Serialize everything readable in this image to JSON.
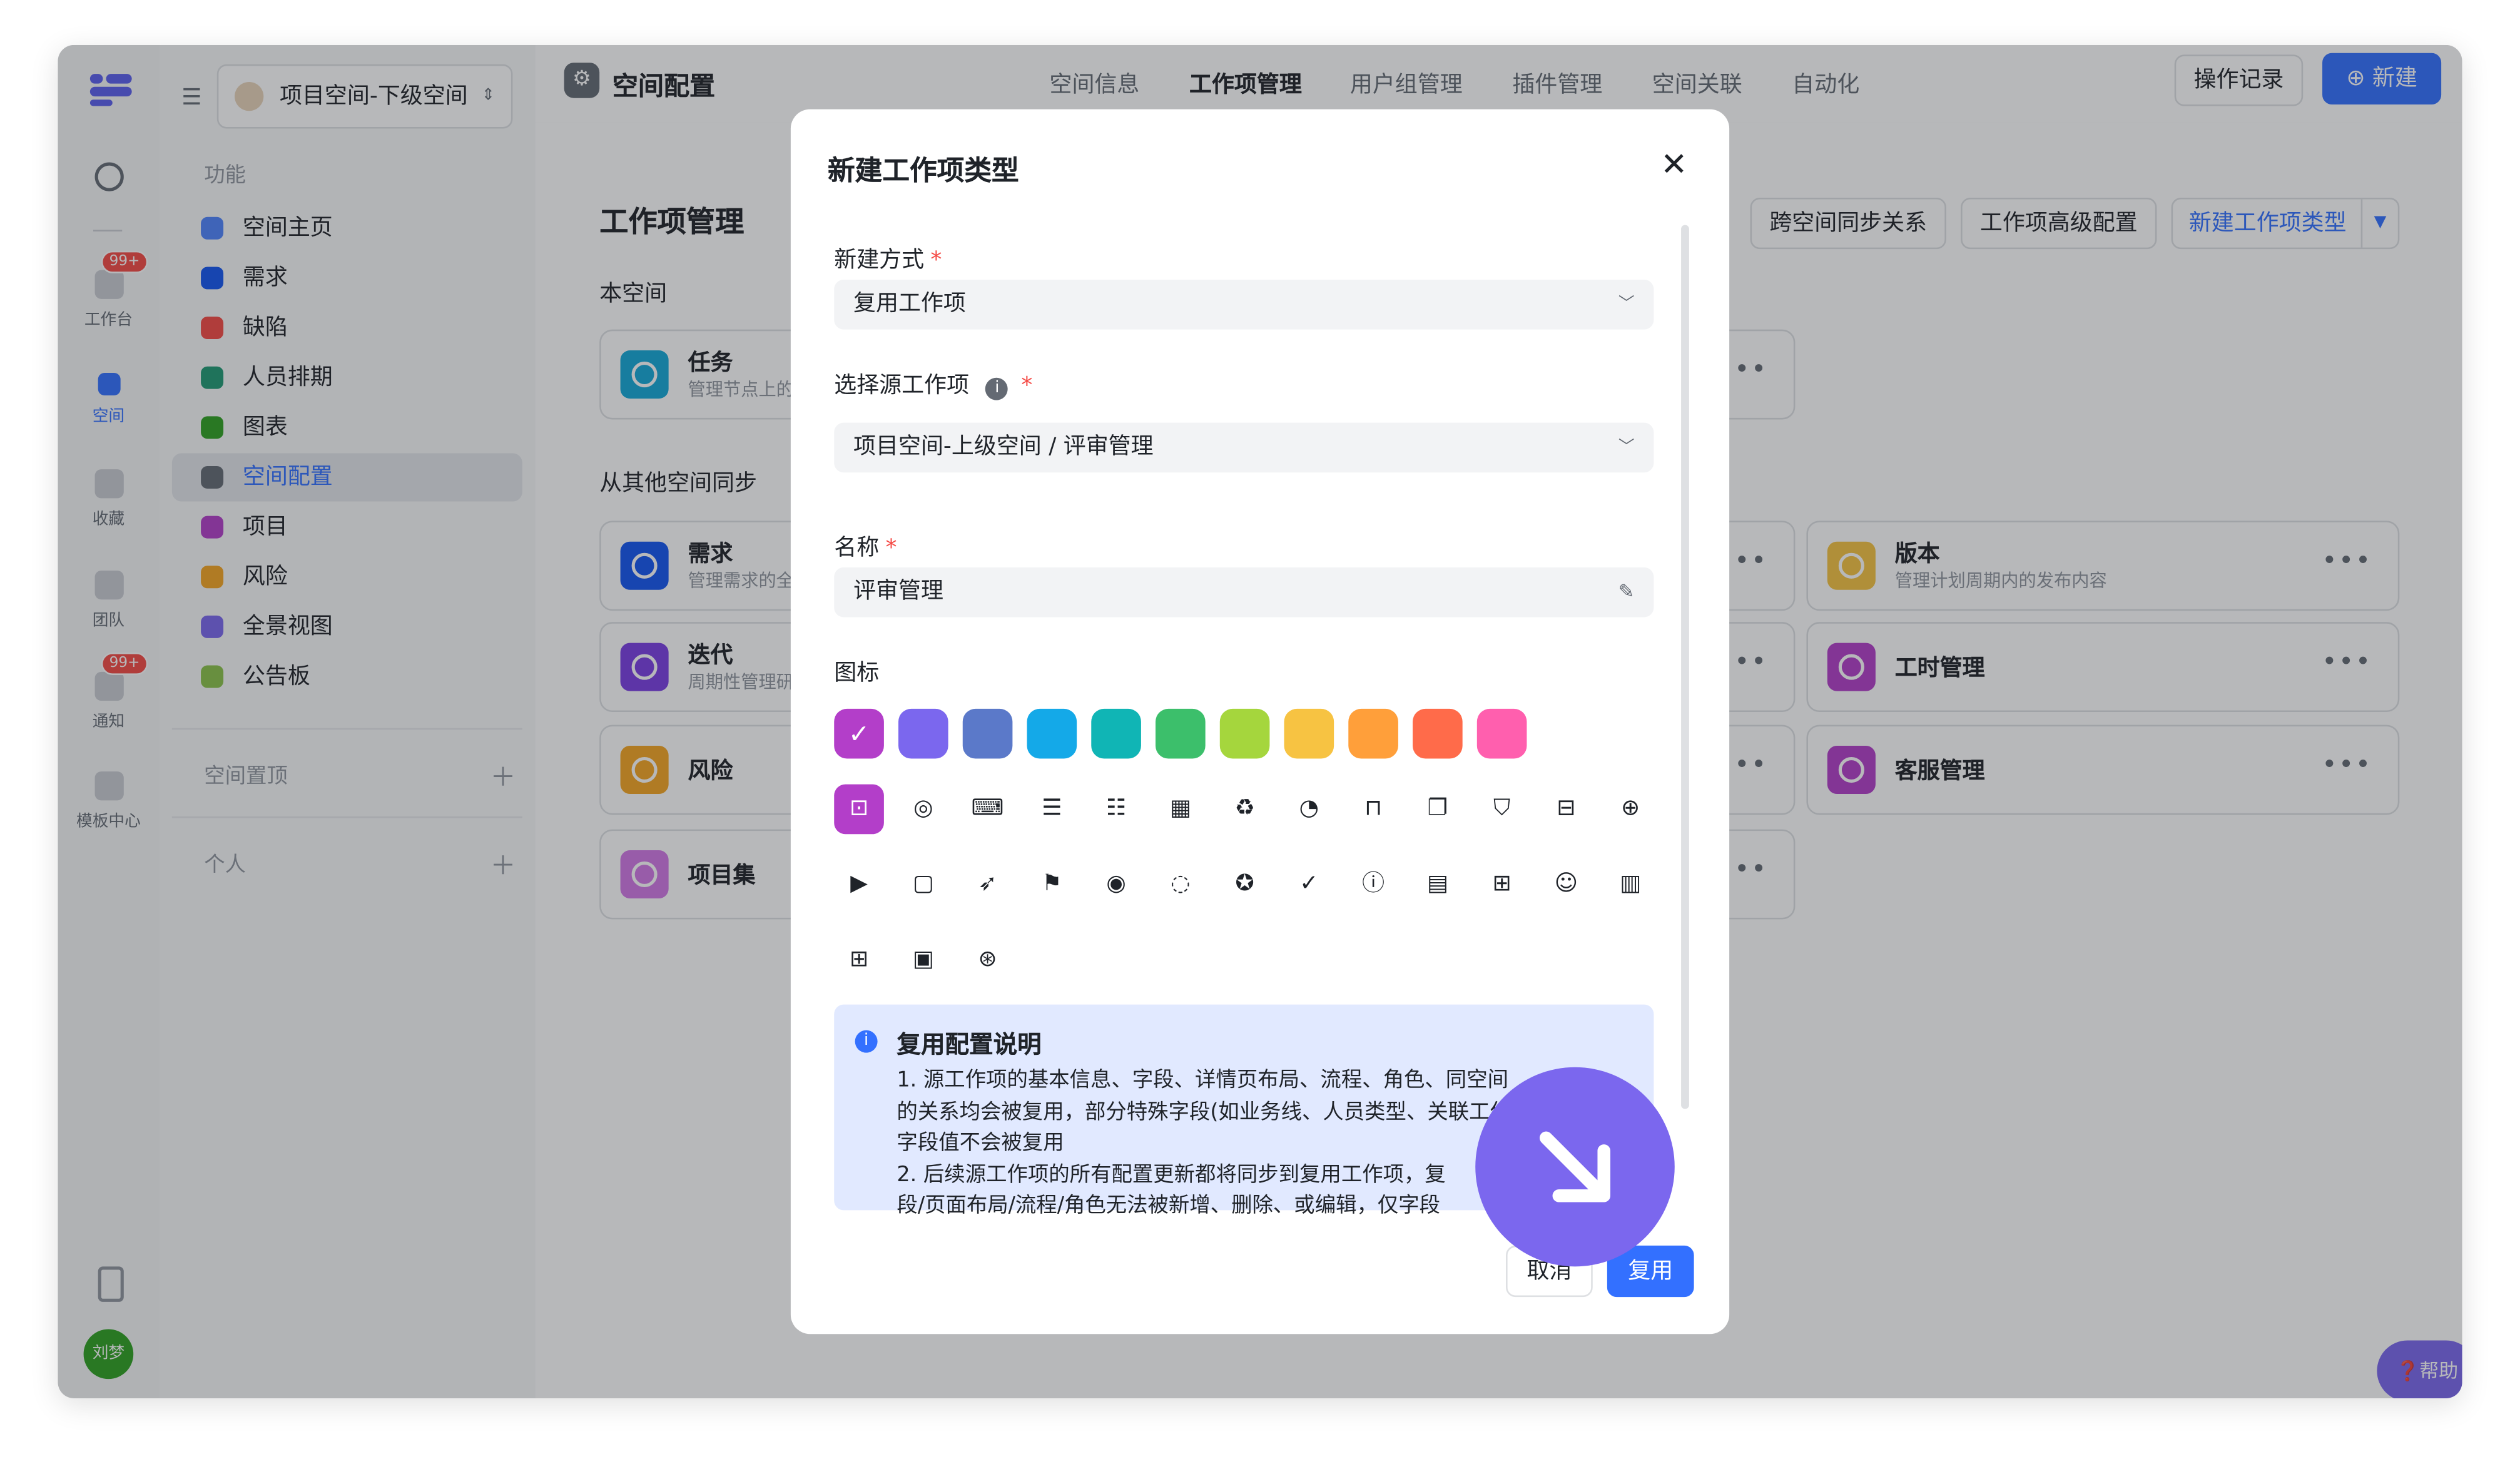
{
  "rail": {
    "items": [
      {
        "label": "工作台",
        "badge": "99+"
      },
      {
        "label": "空间"
      },
      {
        "label": "收藏"
      },
      {
        "label": "团队"
      },
      {
        "label": "通知",
        "badge": "99+"
      },
      {
        "label": "模板中心"
      }
    ],
    "avatar": "刘梦"
  },
  "sidebar": {
    "project_name": "项目空间-下级空间",
    "section_function": "功能",
    "items": [
      {
        "label": "空间主页",
        "color": "#4e83fd"
      },
      {
        "label": "需求",
        "color": "#1456f0"
      },
      {
        "label": "缺陷",
        "color": "#f54a45"
      },
      {
        "label": "人员排期",
        "color": "#1f9a74"
      },
      {
        "label": "图表",
        "color": "#2ea121"
      },
      {
        "label": "空间配置",
        "color": "#646a73"
      },
      {
        "label": "项目",
        "color": "#b33ec9"
      },
      {
        "label": "风险",
        "color": "#f5a623"
      },
      {
        "label": "全景视图",
        "color": "#7b67ee"
      },
      {
        "label": "公告板",
        "color": "#8bc34a"
      }
    ],
    "section_pinned": "空间置顶",
    "section_personal": "个人"
  },
  "header": {
    "title": "空间配置",
    "tabs": [
      "空间信息",
      "工作项管理",
      "用户组管理",
      "插件管理",
      "空间关联",
      "自动化"
    ],
    "active_tab": "工作项管理",
    "log_button": "操作记录",
    "new_button": "新建"
  },
  "main": {
    "title": "工作项管理",
    "sync_button": "跨空间同步关系",
    "advanced_button": "工作项高级配置",
    "new_type_button": "新建工作项类型",
    "section_this": "本空间",
    "section_other": "从其他空间同步",
    "cards_left": [
      {
        "name": "任务",
        "desc": "管理节点上的",
        "color": "#14a9d8"
      },
      {
        "name": "需求",
        "desc": "管理需求的全",
        "color": "#1456f0"
      },
      {
        "name": "迭代",
        "desc": "周期性管理研",
        "color": "#7b3fe4"
      },
      {
        "name": "风险",
        "desc": "",
        "color": "#f5a623"
      },
      {
        "name": "项目集",
        "desc": "",
        "color": "#d278e6"
      }
    ],
    "cards_right": [
      {
        "name": "版本",
        "desc": "管理计划周期内的发布内容",
        "color": "#f5c342"
      },
      {
        "name": "工时管理",
        "desc": "",
        "color": "#b33ec9"
      },
      {
        "name": "客服管理",
        "desc": "",
        "color": "#b33ec9"
      }
    ],
    "help_label": "帮助"
  },
  "modal": {
    "title": "新建工作项类型",
    "create_mode_label": "新建方式",
    "create_mode_value": "复用工作项",
    "source_label": "选择源工作项",
    "source_value": "项目空间-上级空间 / 评审管理",
    "name_label": "名称",
    "name_value": "评审管理",
    "icon_label": "图标",
    "colors": [
      "#b33ec9",
      "#7b67ee",
      "#5b79c9",
      "#14a9e8",
      "#10b5b5",
      "#3cbf6b",
      "#a5d63d",
      "#f7c342",
      "#ff9f3a",
      "#ff6b4a",
      "#ff5fae"
    ],
    "selected_color": "#b33ec9",
    "icons": [
      "bookmark-icon",
      "swirl-icon",
      "keyboard-icon",
      "list-icon",
      "stack-icon",
      "grid-icon",
      "recycle-icon",
      "pie-icon",
      "presentation-icon",
      "book-icon",
      "shield-icon",
      "archive-icon",
      "globe-icon",
      "play-icon",
      "folder-icon",
      "rocket-icon",
      "flag-icon",
      "target-icon",
      "dotted-circle-icon",
      "badge-check-icon",
      "check-circle-icon",
      "alert-circle-icon",
      "table-icon",
      "calc-icon",
      "user-circle-icon",
      "bar-chart-icon",
      "apps-icon",
      "qrcode-icon",
      "basketball-icon"
    ],
    "info_title": "复用配置说明",
    "info_line1": "1. 源工作项的基本信息、字段、详情页布局、流程、角色、同空间",
    "info_line1b": "的关系均会被复用，部分特殊字段(如业务线、人员类型、关联工作项",
    "info_line1c": "字段值不会被复用",
    "info_line2": "2. 后续源工作项的所有配置更新都将同步到复用工作项，复",
    "info_line2b": "段/页面布局/流程/角色无法被新增、删除、或编辑，仅字段",
    "cancel_label": "取消",
    "confirm_label": "复用"
  }
}
